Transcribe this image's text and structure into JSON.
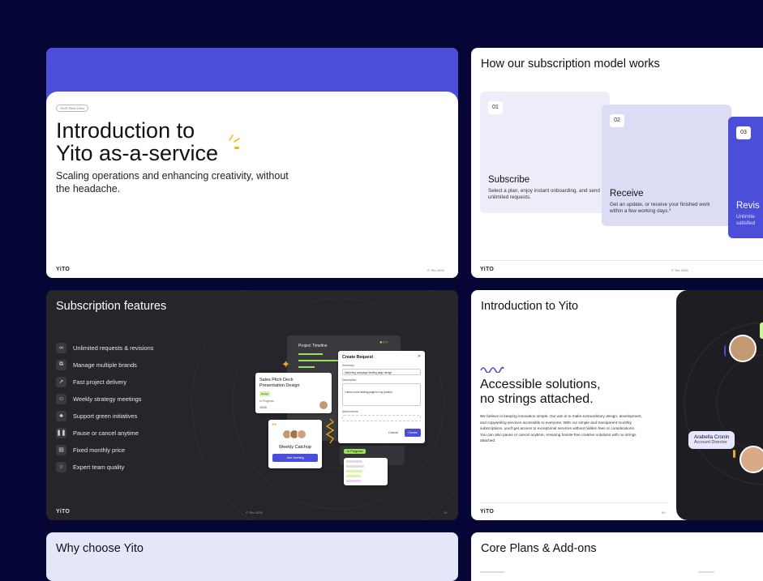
{
  "slides": {
    "intro": {
      "tag": "Yito® Pitch Deck",
      "title_line1": "Introduction to",
      "title_line2": "Yito as-a-service",
      "subtitle": "Scaling operations and enhancing creativity, without the headache.",
      "logo": "YiTO",
      "footer": "© Yito 2024"
    },
    "model": {
      "title": "How our subscription model works",
      "steps": [
        {
          "num": "01",
          "heading": "Subscribe",
          "desc": "Select a plan, enjoy instant onboarding, and send unlimited requests."
        },
        {
          "num": "02",
          "heading": "Receive",
          "desc": "Get an update, or receive your finished work within a few working days.*"
        },
        {
          "num": "03",
          "heading": "Revis",
          "desc": "Unlimite satisfied"
        }
      ],
      "logo": "YiTO",
      "footer": "© Yito 2024"
    },
    "features": {
      "title": "Subscription features",
      "items": [
        {
          "label": "Unlimited requests & revisions",
          "icon": "infinity-icon",
          "glyph": "∞"
        },
        {
          "label": "Manage multiple brands",
          "icon": "layers-icon",
          "glyph": "⧉"
        },
        {
          "label": "Fast project delivery",
          "icon": "rocket-icon",
          "glyph": "➚"
        },
        {
          "label": "Weekly strategy meetings",
          "icon": "user-icon",
          "glyph": "☺"
        },
        {
          "label": "Support green initiatives",
          "icon": "leaf-icon",
          "glyph": "♣"
        },
        {
          "label": "Pause or cancel anytime",
          "icon": "pause-icon",
          "glyph": "❚❚"
        },
        {
          "label": "Fixed monthly price",
          "icon": "receipt-icon",
          "glyph": "▤"
        },
        {
          "label": "Expert team quality",
          "icon": "star-icon",
          "glyph": "☆"
        }
      ],
      "mock": {
        "timeline": "Project Timeline",
        "create": "Create Request",
        "summary_label": "Summary",
        "summary_value": "Marketing campaign landing page design",
        "desc_label": "Description",
        "desc_value": "I need a new landing page for my product",
        "attach_label": "Attachments",
        "cancel": "Cancel",
        "create_btn": "Create",
        "card_title": "Sales Pitch Deck Presentation Design",
        "card_tag": "Design",
        "card_progress": "In Progress",
        "card_count": "10/15",
        "catchup": "Weekly Catchup",
        "join": "Join meeting",
        "status": "In Progress"
      },
      "logo": "YiTO",
      "footer": "© Yito 2024",
      "page": "10"
    },
    "intro2": {
      "title": "Introduction to Yito",
      "heading1": "Accessible solutions,",
      "heading2": "no strings attached.",
      "body": "We believe in keeping innovation simple. Our aim is to make extraordinary design, development, and copywriting services accessible to everyone. With our simple and transparent monthly subscriptions, you'll get access to exceptional services without hidden fees or complications. You can also pause or cancel anytime, ensuring hassle-free creative solutions with no strings attached.",
      "person_name": "Arabella Cronin",
      "person_role": "Account Director",
      "logo": "YiTO",
      "page": "09"
    },
    "why": {
      "title": "Why choose Yito"
    },
    "plans": {
      "title": "Core Plans & Add-ons"
    }
  }
}
